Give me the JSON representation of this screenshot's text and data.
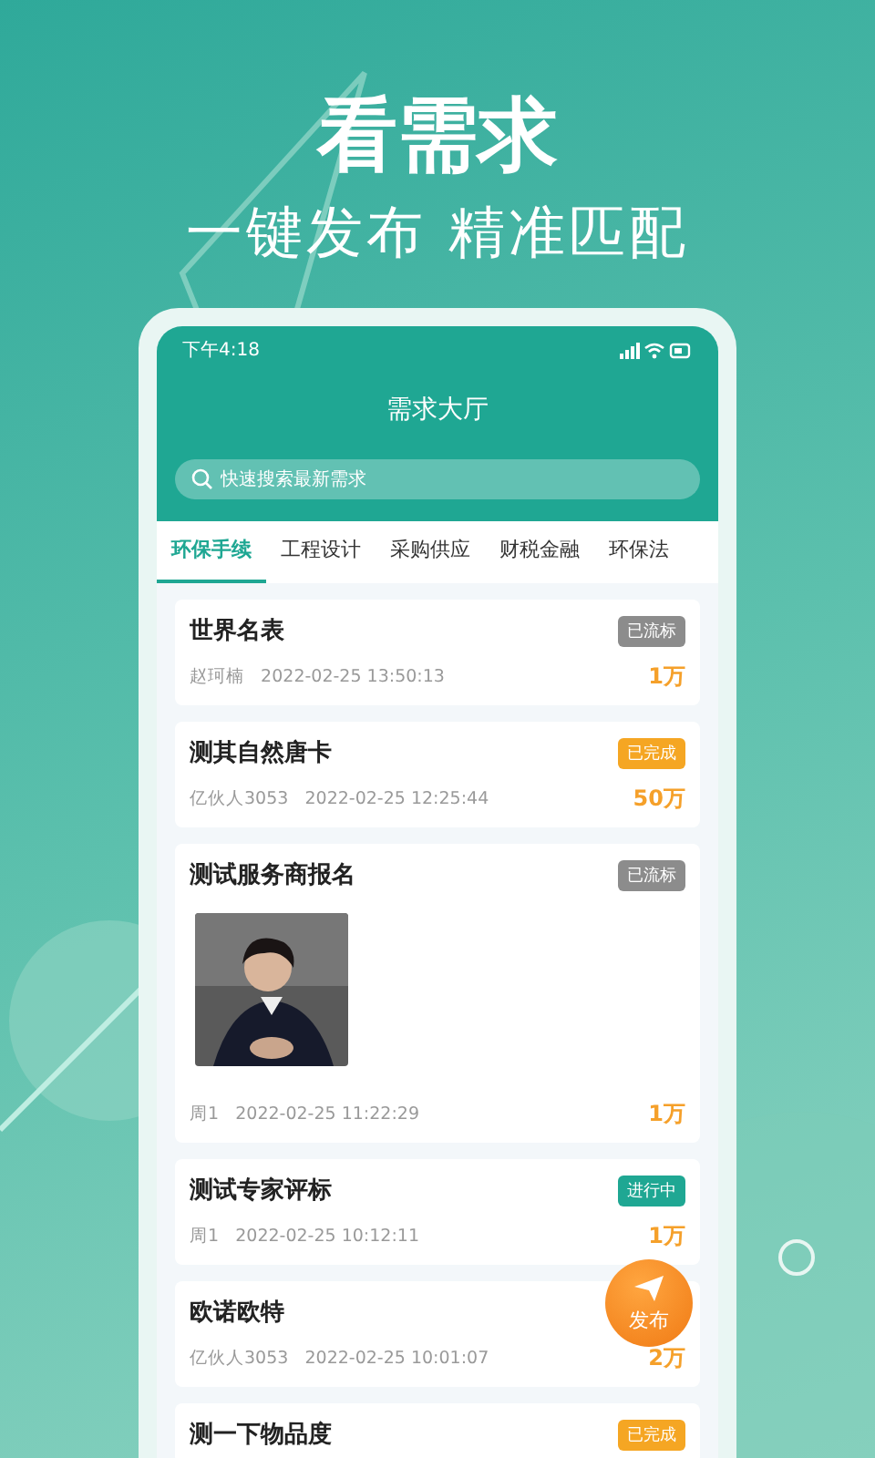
{
  "headline": "看需求",
  "tagline": "一键发布 精准匹配",
  "status_bar": {
    "time": "下午4:18"
  },
  "header": {
    "title": "需求大厅"
  },
  "search": {
    "placeholder": "快速搜索最新需求"
  },
  "tabs": [
    {
      "label": "环保手续",
      "selected": true
    },
    {
      "label": "工程设计",
      "selected": false
    },
    {
      "label": "采购供应",
      "selected": false
    },
    {
      "label": "财税金融",
      "selected": false
    },
    {
      "label": "环保法",
      "selected": false
    }
  ],
  "demands": [
    {
      "title": "世界名表",
      "status": {
        "label": "已流标",
        "kind": "lapsed"
      },
      "author": "赵珂楠",
      "time": "2022-02-25 13:50:13",
      "amount": "1万"
    },
    {
      "title": "测其自然唐卡",
      "status": {
        "label": "已完成",
        "kind": "done"
      },
      "author": "亿伙人3053",
      "time": "2022-02-25 12:25:44",
      "amount": "50万"
    },
    {
      "title": "测试服务商报名",
      "status": {
        "label": "已流标",
        "kind": "lapsed"
      },
      "kind": "picture",
      "author": "周1",
      "time": "2022-02-25 11:22:29",
      "amount": "1万"
    },
    {
      "title": "测试专家评标",
      "status": {
        "label": "进行中",
        "kind": "ongoing"
      },
      "author": "周1",
      "time": "2022-02-25 10:12:11",
      "amount": "1万"
    },
    {
      "title": "欧诺欧特",
      "author": "亿伙人3053",
      "time": "2022-02-25 10:01:07",
      "amount": "2万"
    },
    {
      "title": "测一下物品度",
      "status": {
        "label": "已完成",
        "kind": "done"
      }
    }
  ],
  "fab": {
    "label": "发布"
  }
}
